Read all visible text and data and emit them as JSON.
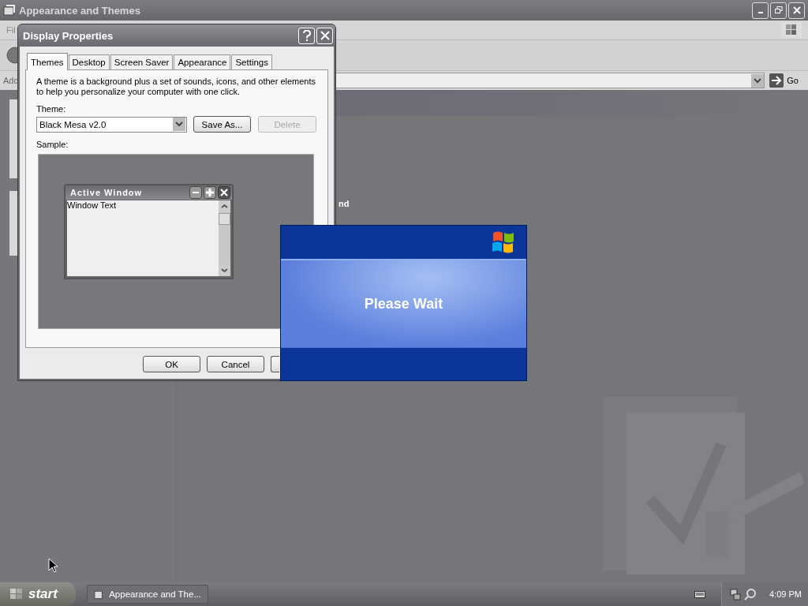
{
  "explorer": {
    "title": "Appearance and Themes",
    "menu_text": "Fil",
    "address_label": "Add",
    "go": "Go",
    "content_text": "nd"
  },
  "dialog": {
    "title": "Display Properties",
    "tabs": [
      {
        "label": "Themes",
        "selected": true
      },
      {
        "label": "Desktop",
        "selected": false
      },
      {
        "label": "Screen Saver",
        "selected": false
      },
      {
        "label": "Appearance",
        "selected": false
      },
      {
        "label": "Settings",
        "selected": false
      }
    ],
    "description": "A theme is a background plus a set of sounds, icons, and other elements to help you personalize your computer with one click.",
    "theme_label": "Theme:",
    "theme_value": "Black Mesa v2.0",
    "buttons": [
      {
        "label": "Save As...",
        "disabled": false
      },
      {
        "label": "Delete",
        "disabled": true
      }
    ],
    "sample_label": "Sample:",
    "sample_window": {
      "title": "Active Window",
      "text": "Window Text"
    },
    "footer_buttons": [
      "OK",
      "Cancel"
    ]
  },
  "splash": {
    "text": "Please Wait"
  },
  "taskbar": {
    "start": "start",
    "tasks": [
      {
        "label": "Appearance and The...",
        "selected": false
      }
    ],
    "clock": "4:09 PM"
  }
}
